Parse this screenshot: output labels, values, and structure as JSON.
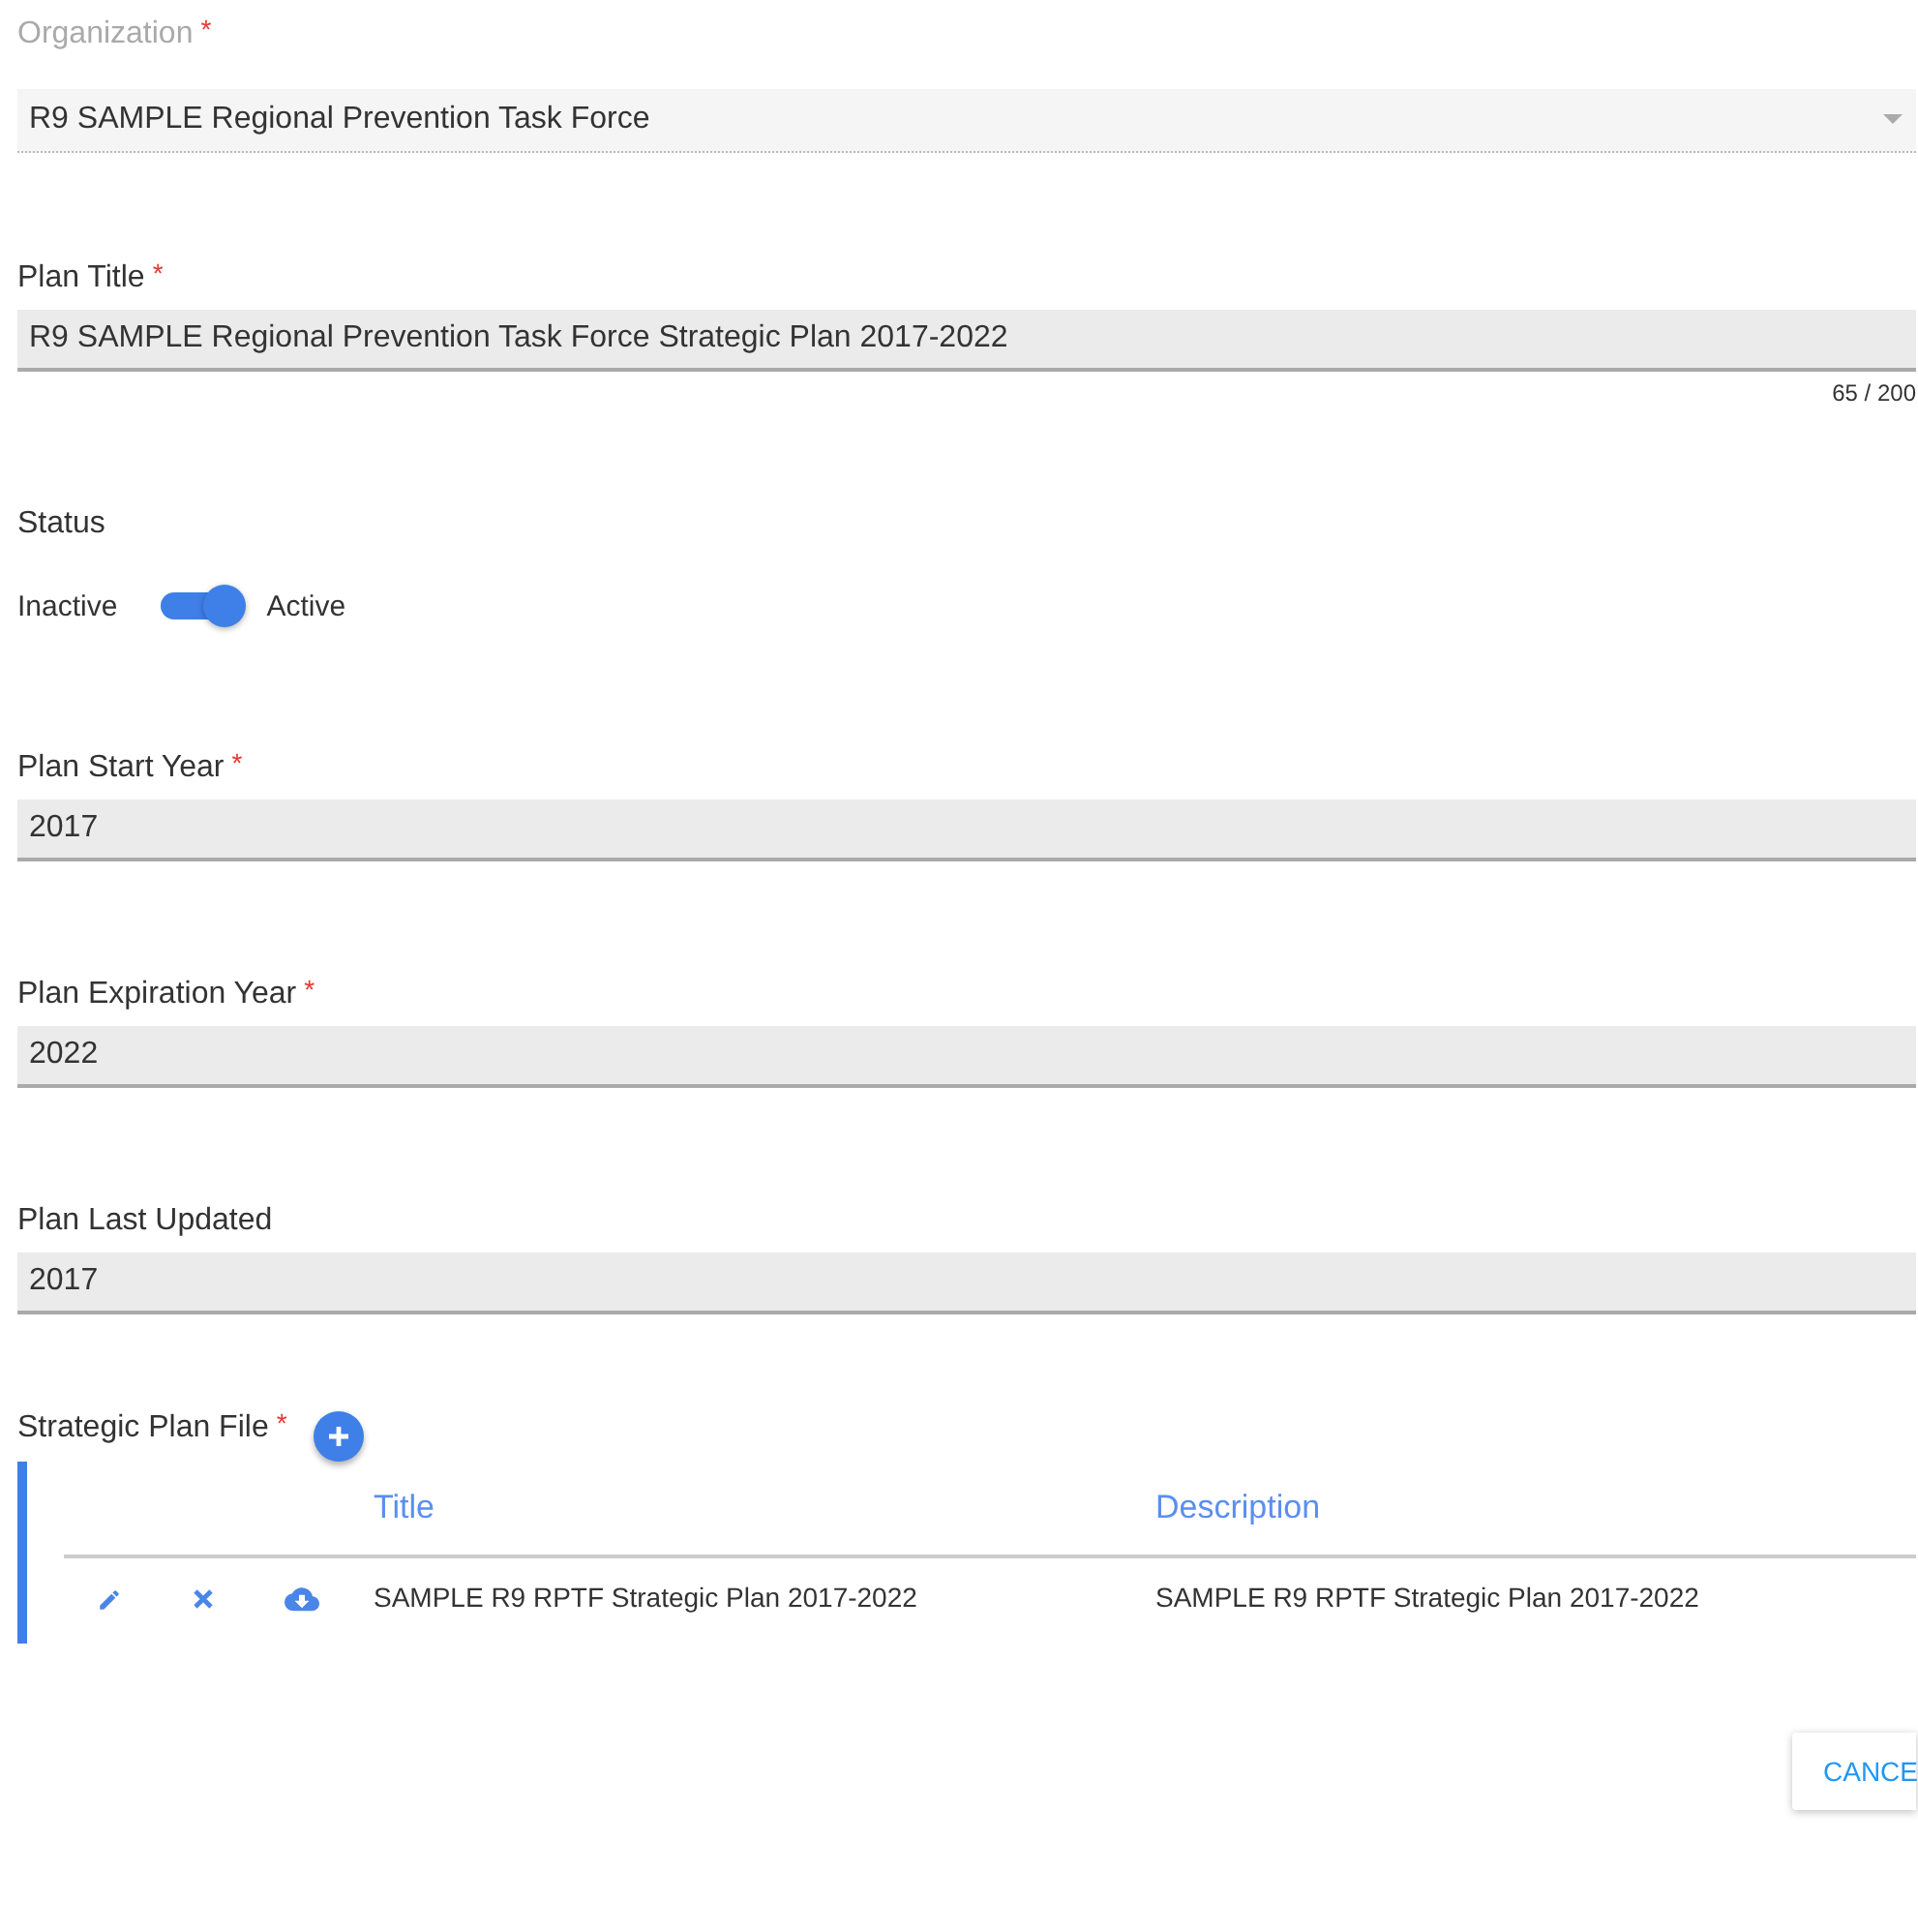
{
  "fields": [
    {
      "kind": "select",
      "label": "Organization",
      "required_mark": "*",
      "disabled": true,
      "value": "R9 SAMPLE Regional Prevention Task Force"
    },
    {
      "kind": "text",
      "label": "Plan Title",
      "required_mark": "*",
      "disabled": false,
      "value": "R9 SAMPLE Regional Prevention Task Force Strategic Plan 2017-2022",
      "counter": "65 / 200"
    },
    {
      "kind": "switch",
      "label": "Status",
      "off_label": "Inactive",
      "on_label": "Active",
      "on": true
    },
    {
      "kind": "text",
      "label": "Plan Start Year",
      "required_mark": "*",
      "disabled": false,
      "value": "2017"
    },
    {
      "kind": "text",
      "label": "Plan Expiration Year",
      "required_mark": "*",
      "disabled": false,
      "value": "2022"
    },
    {
      "kind": "text",
      "label": "Plan Last Updated",
      "disabled": false,
      "value": "2017"
    }
  ],
  "file_section": {
    "label": "Strategic Plan File",
    "required_mark": "*",
    "columns": [
      "Title",
      "Description"
    ],
    "rows": [
      {
        "title": "SAMPLE R9 RPTF Strategic Plan 2017-2022",
        "description": "SAMPLE R9 RPTF Strategic Plan 2017-2022"
      }
    ]
  },
  "buttons": [
    "CANCE"
  ]
}
